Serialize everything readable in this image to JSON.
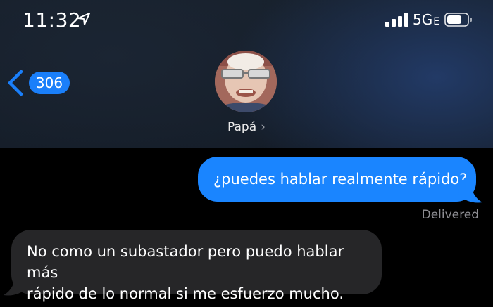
{
  "status_bar": {
    "time": "11:32",
    "network": "5G",
    "network_suffix": "E"
  },
  "header": {
    "back_count": "306",
    "contact_name": "Papá",
    "accent_color": "#1a7ffa"
  },
  "messages": [
    {
      "direction": "outgoing",
      "text": "¿puedes hablar realmente rápido?",
      "status": "Delivered"
    },
    {
      "direction": "incoming",
      "line1": "No como un subastador pero puedo hablar más",
      "line2": "rápido de lo normal si me esfuerzo mucho."
    }
  ],
  "icons": [
    "location-arrow-icon",
    "signal-bars-icon",
    "battery-icon",
    "back-chevron-icon",
    "contact-chevron-icon"
  ]
}
